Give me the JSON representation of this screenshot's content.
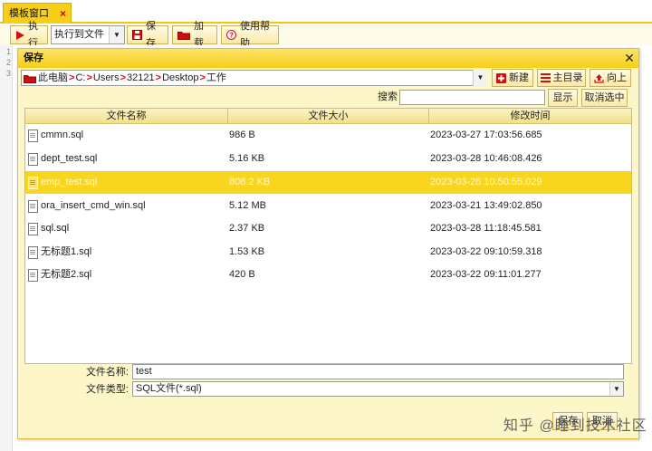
{
  "tab": {
    "label": "模板窗口",
    "close": "×"
  },
  "toolbar": {
    "run_label": "执行",
    "mode_select": "执行到文件",
    "save_label": "保存",
    "load_label": "加载",
    "help_label": "使用帮助"
  },
  "editor": {
    "line_numbers": [
      "1",
      "2",
      "3"
    ]
  },
  "dialog": {
    "title": "保存",
    "close": "✕",
    "path_segments": [
      "此电脑",
      "C:",
      "Users",
      "32121",
      "Desktop",
      "工作"
    ],
    "path_separator": ">",
    "new_label": "新建",
    "home_label": "主目录",
    "up_label": "向上",
    "search_label": "搜索",
    "search_value": "",
    "show_label": "显示",
    "deselect_label": "取消选中",
    "columns": [
      "文件名称",
      "文件大小",
      "修改时间"
    ],
    "files": [
      {
        "name": "cmmn.sql",
        "size": "986 B",
        "mtime": "2023-03-27 17:03:56.685",
        "selected": false
      },
      {
        "name": "dept_test.sql",
        "size": "5.16 KB",
        "mtime": "2023-03-28 10:46:08.426",
        "selected": false
      },
      {
        "name": "emp_test.sql",
        "size": "808.2 KB",
        "mtime": "2023-03-28 10:50:55.029",
        "selected": true
      },
      {
        "name": "ora_insert_cmd_win.sql",
        "size": "5.12 MB",
        "mtime": "2023-03-21 13:49:02.850",
        "selected": false
      },
      {
        "name": "sql.sql",
        "size": "2.37 KB",
        "mtime": "2023-03-28 11:18:45.581",
        "selected": false
      },
      {
        "name": "无标题1.sql",
        "size": "1.53 KB",
        "mtime": "2023-03-22 09:10:59.318",
        "selected": false
      },
      {
        "name": "无标题2.sql",
        "size": "420 B",
        "mtime": "2023-03-22 09:11:01.277",
        "selected": false
      }
    ],
    "filename_label": "文件名称:",
    "filename_value": "test",
    "filetype_label": "文件类型:",
    "filetype_value": "SQL文件(*.sql)",
    "confirm_label": "保存",
    "cancel_label": "取消"
  },
  "watermark": "知乎 @睡到技术社区",
  "colors": {
    "accent": "#f7cf18",
    "selection": "#f8d51f",
    "dialog_bg": "#fdf6c8",
    "danger": "#d01010"
  }
}
